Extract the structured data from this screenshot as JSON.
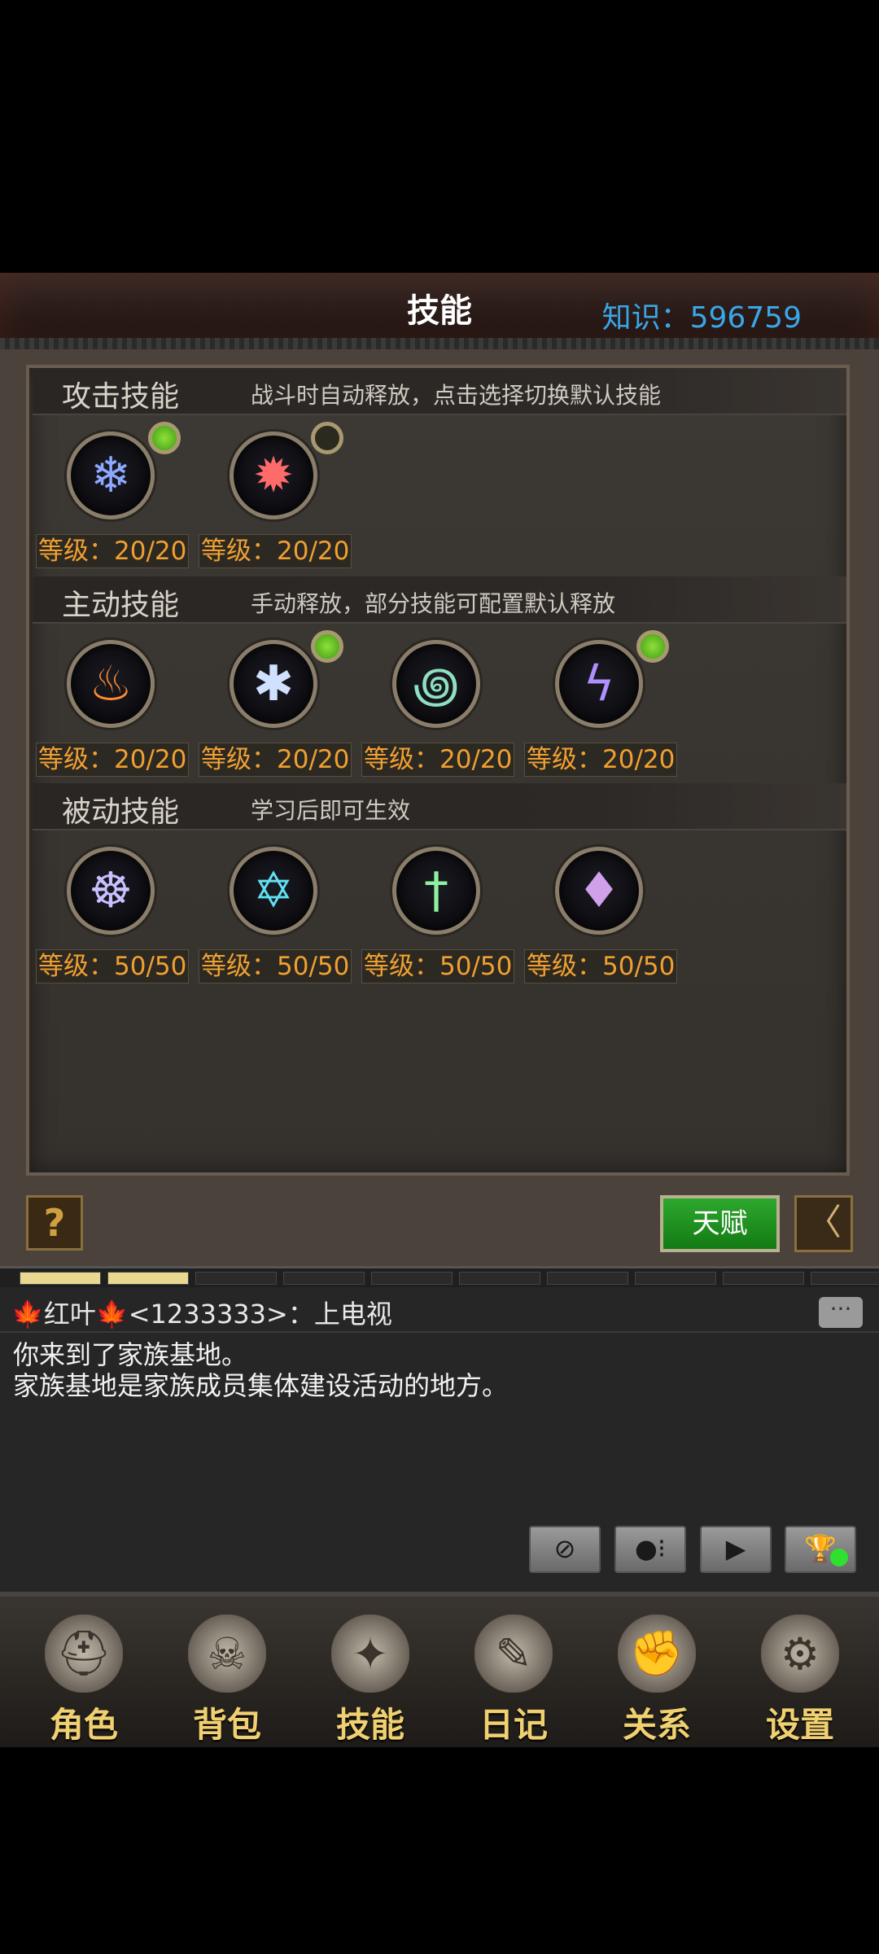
{
  "header": {
    "title": "技能",
    "knowledge": "知识：596759"
  },
  "sections": {
    "attack": {
      "title": "攻击技能",
      "desc": "战斗时自动释放，点击选择切换默认技能",
      "skills": [
        {
          "icon": "snowflake-icon",
          "glyph": "❄",
          "color": "#8da8ff",
          "level": "等级：20/20",
          "selected": true
        },
        {
          "icon": "sun-burst-icon",
          "glyph": "✹",
          "color": "#ff6a6a",
          "level": "等级：20/20",
          "selected": false
        }
      ]
    },
    "active": {
      "title": "主动技能",
      "desc": "手动释放，部分技能可配置默认释放",
      "skills": [
        {
          "icon": "flame-icon",
          "glyph": "♨",
          "color": "#ff8a30",
          "level": "等级：20/20"
        },
        {
          "icon": "frost-shield-icon",
          "glyph": "✱",
          "color": "#d0e0ff",
          "level": "等级：20/20",
          "selected": true
        },
        {
          "icon": "whirlwind-icon",
          "glyph": "꩜",
          "color": "#8ee0c0",
          "level": "等级：20/20"
        },
        {
          "icon": "lightning-icon",
          "glyph": "ϟ",
          "color": "#b090ff",
          "level": "等级：20/20",
          "selected": true
        }
      ]
    },
    "passive": {
      "title": "被动技能",
      "desc": "学习后即可生效",
      "skills": [
        {
          "icon": "meditation-icon",
          "glyph": "☸",
          "color": "#c8c0ff",
          "level": "等级：50/50"
        },
        {
          "icon": "hexagram-icon",
          "glyph": "✡",
          "color": "#60e0f0",
          "level": "等级：50/50"
        },
        {
          "icon": "sword-icon",
          "glyph": "†",
          "color": "#90f0a0",
          "level": "等级：50/50"
        },
        {
          "icon": "crystal-icon",
          "glyph": "♦",
          "color": "#d0a0e8",
          "level": "等级：50/50"
        }
      ]
    }
  },
  "buttons": {
    "help": "?",
    "talent": "天赋",
    "back": "〈"
  },
  "chat": {
    "name_line": "🍁红叶🍁<1233333>：上电视",
    "lines": [
      "你来到了家族基地。",
      "家族基地是家族成员集体建设活动的地方。"
    ],
    "bubble": "···",
    "controls": [
      "⊘",
      "●⁝",
      "▶",
      "🏆"
    ]
  },
  "nav": [
    {
      "label": "角色",
      "icon": "helmet-icon",
      "glyph": "⛑"
    },
    {
      "label": "背包",
      "icon": "backpack-icon",
      "glyph": "☠"
    },
    {
      "label": "技能",
      "icon": "spellbook-icon",
      "glyph": "✦"
    },
    {
      "label": "日记",
      "icon": "scroll-icon",
      "glyph": "✎"
    },
    {
      "label": "关系",
      "icon": "gauntlets-icon",
      "glyph": "✊"
    },
    {
      "label": "设置",
      "icon": "gears-icon",
      "glyph": "⚙"
    }
  ]
}
